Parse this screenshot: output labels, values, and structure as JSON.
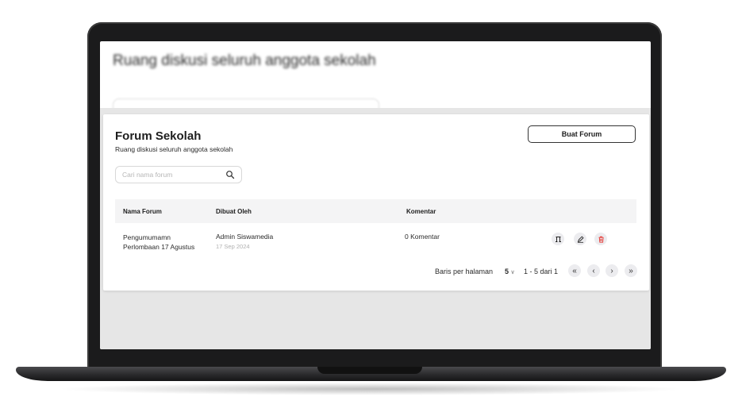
{
  "background_page": {
    "title": "Ruang diskusi seluruh anggota sekolah"
  },
  "forum": {
    "title": "Forum Sekolah",
    "subtitle": "Ruang diskusi seluruh anggota sekolah",
    "create_button": "Buat Forum",
    "search_placeholder": "Cari nama forum",
    "columns": [
      "Nama Forum",
      "Dibuat Oleh",
      "Komentar"
    ],
    "rows": [
      {
        "name_line1": "Pengumumamn",
        "name_line2": "Perlombaan 17 Agustus",
        "author": "Admin Siswamedia",
        "date": "17 Sep 2024",
        "comments": "0 Komentar"
      }
    ],
    "row_actions": [
      "pin-icon",
      "edit-icon",
      "delete-icon"
    ],
    "pagination": {
      "rows_per_page_label": "Baris per halaman",
      "rows_per_page_value": "5",
      "range_text": "1 - 5 dari 1",
      "first": "«",
      "prev": "‹",
      "next": "›",
      "last": "»"
    }
  },
  "colors": {
    "delete_icon": "#e53935",
    "text_primary": "#1e1e1e",
    "table_header_bg": "#f4f4f5"
  }
}
